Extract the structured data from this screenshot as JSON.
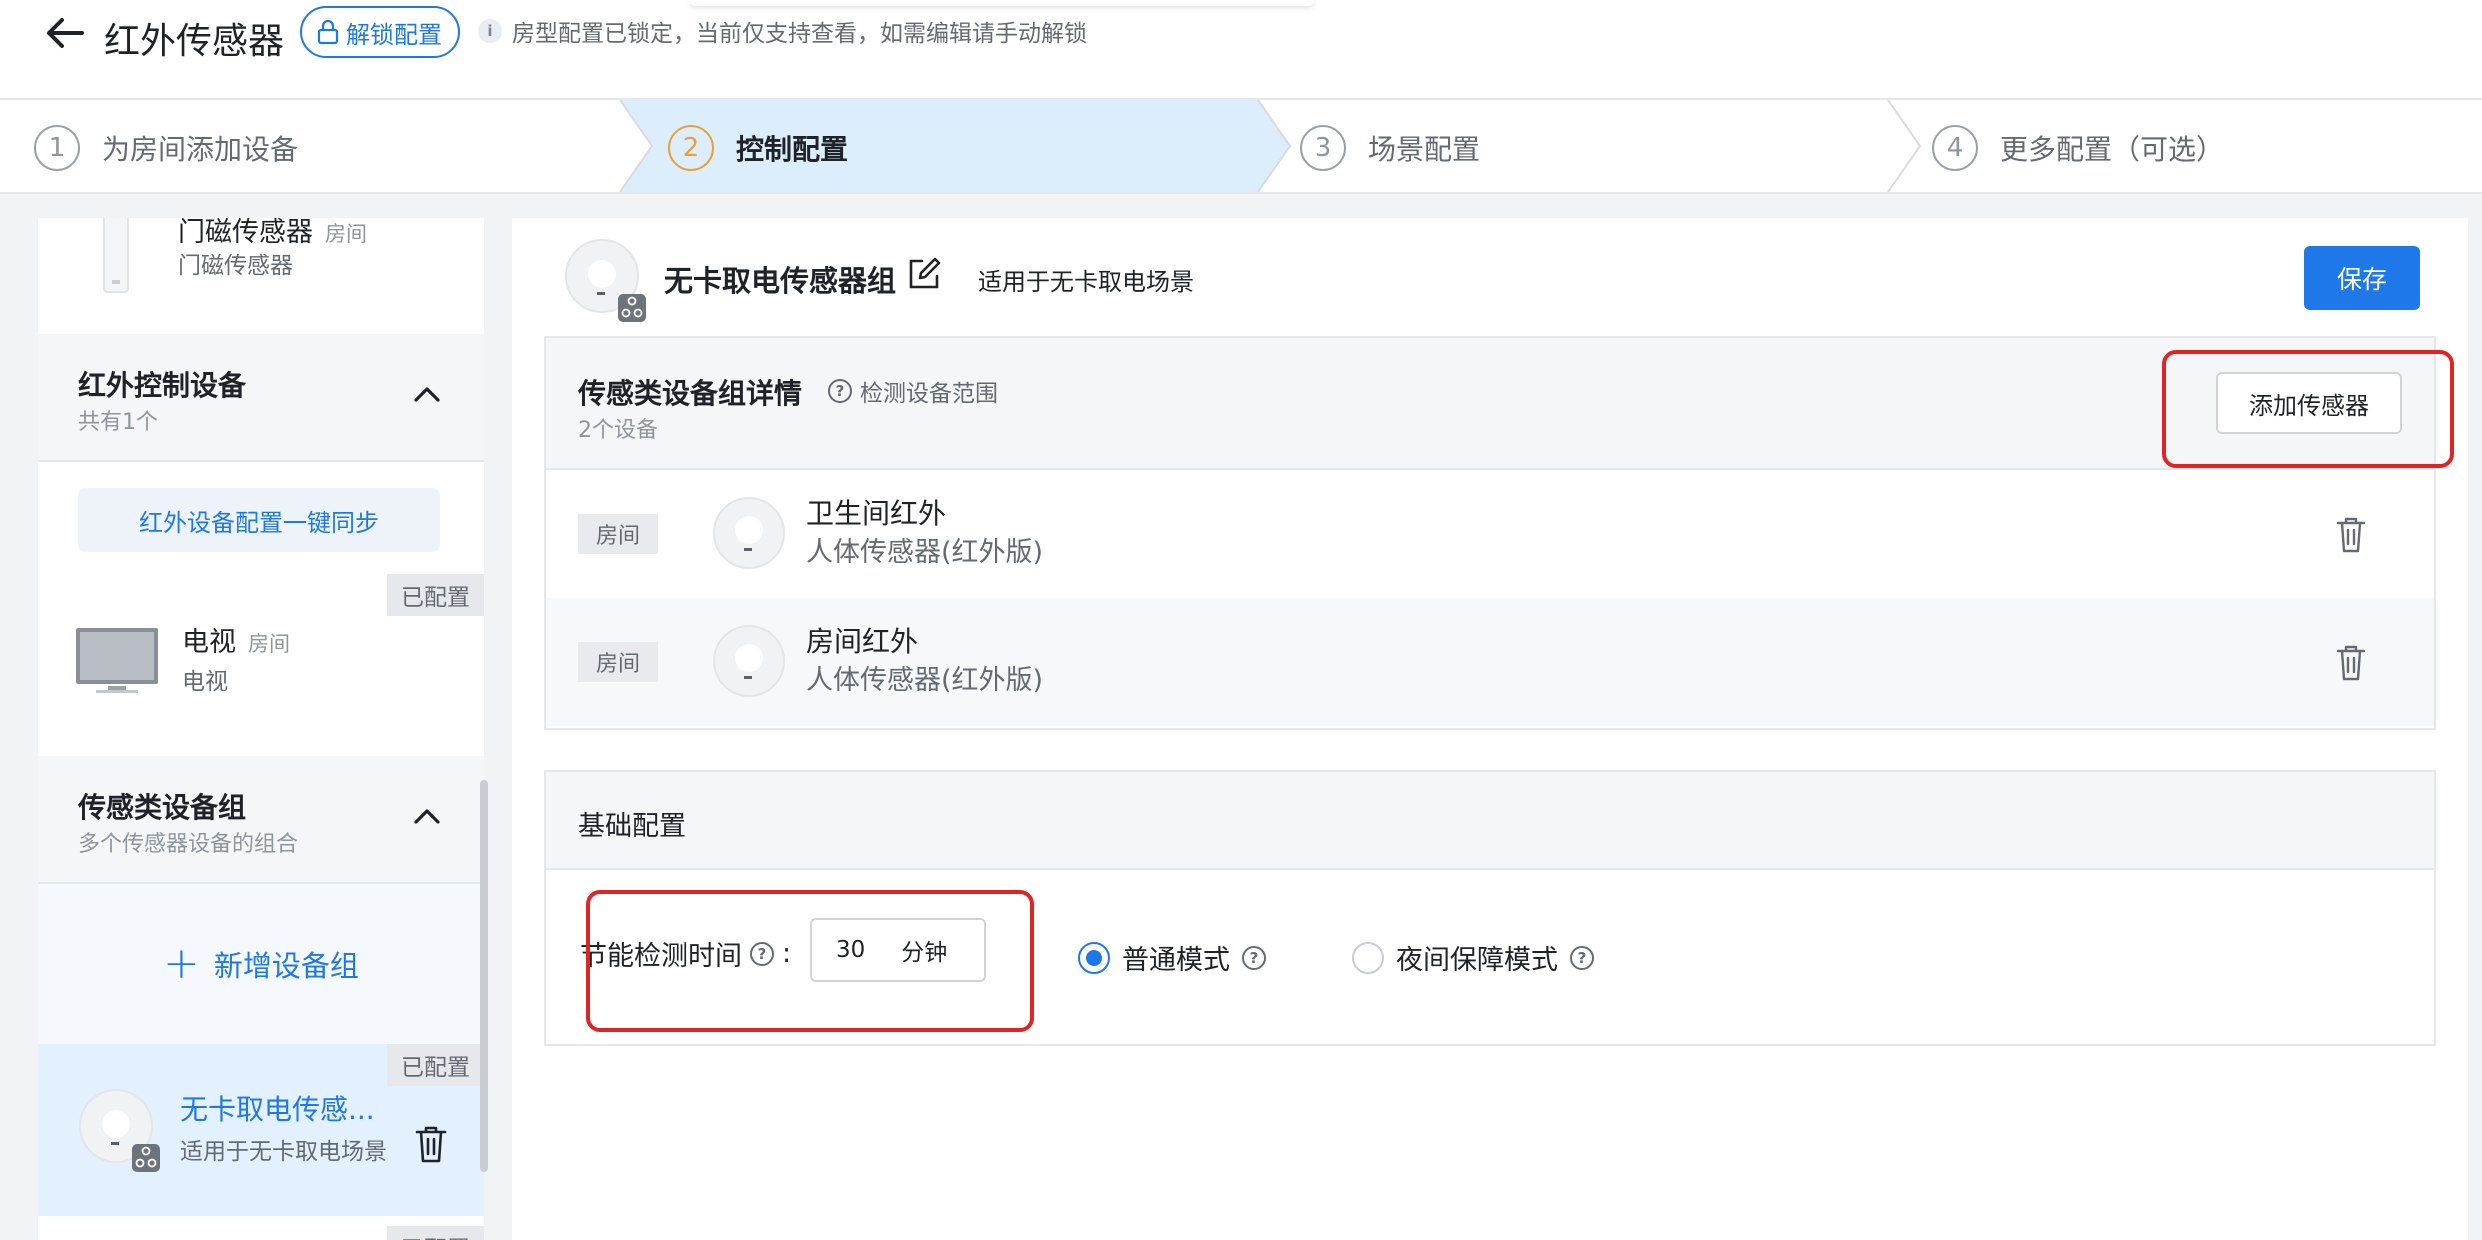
{
  "header": {
    "title": "红外传感器",
    "unlock_label": "解锁配置",
    "notice": "房型配置已锁定，当前仅支持查看，如需编辑请手动解锁"
  },
  "steps": [
    {
      "num": "1",
      "label": "为房间添加设备"
    },
    {
      "num": "2",
      "label": "控制配置"
    },
    {
      "num": "3",
      "label": "场景配置"
    },
    {
      "num": "4",
      "label": "更多配置（可选）"
    }
  ],
  "sidebar": {
    "door_sensor": {
      "name": "门磁传感器",
      "room": "房间",
      "type": "门磁传感器"
    },
    "ir_section": {
      "title": "红外控制设备",
      "sub": "共有1个"
    },
    "sync_label": "红外设备配置一键同步",
    "tv": {
      "tag": "已配置",
      "name": "电视",
      "room": "房间",
      "type": "电视"
    },
    "sensor_section": {
      "title": "传感类设备组",
      "sub": "多个传感器设备的组合"
    },
    "new_group_label": "新增设备组",
    "group_item": {
      "tag": "已配置",
      "name": "无卡取电传感...",
      "sub": "适用于无卡取电场景"
    },
    "next_tag": "已配置"
  },
  "main": {
    "group_title": "无卡取电传感器组",
    "group_desc": "适用于无卡取电场景",
    "save_label": "保存",
    "detail": {
      "title": "传感类设备组详情",
      "range_label": "检测设备范围",
      "count": "2个设备",
      "add_label": "添加传感器",
      "rows": [
        {
          "room": "房间",
          "name": "卫生间红外",
          "type": "人体传感器(红外版)"
        },
        {
          "room": "房间",
          "name": "房间红外",
          "type": "人体传感器(红外版)"
        }
      ]
    },
    "basic": {
      "title": "基础配置",
      "energy_label": "节能检测时间",
      "colon": ":",
      "value": "30",
      "unit": "分钟",
      "mode_normal": "普通模式",
      "mode_night": "夜间保障模式"
    }
  },
  "colors": {
    "accent": "#1f78e8",
    "active_step_bg": "#dceefc",
    "step_active_number": "#e8a13a",
    "highlight": "#e02424"
  }
}
